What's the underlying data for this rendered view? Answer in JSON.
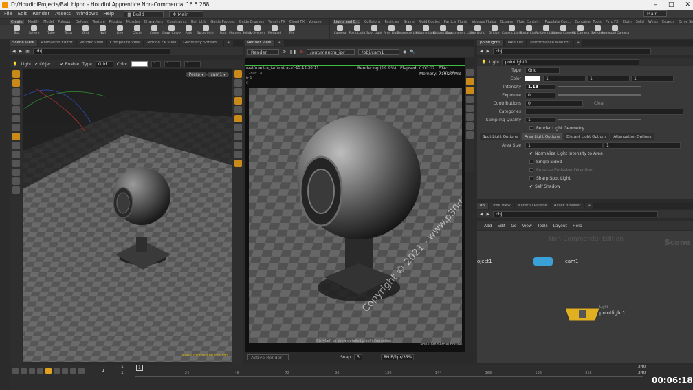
{
  "window": {
    "title": "D:/HoudiniProjects/Ball.hipnc - Houdini Apprentice Non-Commercial 16.5.268",
    "min": "–",
    "max": "□",
    "close": "✕"
  },
  "menu": {
    "items": [
      "File",
      "Edit",
      "Render",
      "Assets",
      "Windows",
      "Help"
    ],
    "build": "Build",
    "desktop": "Main",
    "desktop_right": "Main"
  },
  "shelf_left": {
    "tabs": [
      "Create",
      "Modify",
      "Model",
      "Polygon",
      "Deform",
      "Texture",
      "Rigging",
      "Muscles",
      "Characters",
      "Constraints",
      "Hair Utils",
      "Guide Process",
      "Guide Brushes",
      "Terrain FX",
      "Cloud FX",
      "Volume"
    ],
    "tools": [
      "Box",
      "Sphere",
      "Tube",
      "Torus",
      "Grid",
      "Null",
      "Line",
      "Circle",
      "Curve",
      "Draw Curve",
      "Path",
      "Spray Paint",
      "Font",
      "Platonic Solids",
      "L-System",
      "Metaball",
      "File"
    ]
  },
  "shelf_right": {
    "tabs": [
      "Lights and C...",
      "Collisions",
      "Particles",
      "Grains",
      "Rigid Bodies",
      "Particle Fluids",
      "Viscous Fluids",
      "Oceans",
      "Fluid Contai...",
      "Populate Con...",
      "Container Tools",
      "Pyro FX",
      "Cloth",
      "Solid",
      "Wires",
      "Crowds",
      "Drive Simula..."
    ],
    "tools": [
      "Camera",
      "Point Light",
      "Spot Light",
      "Area Light",
      "Geometry Light",
      "Volume Light",
      "Distant Light",
      "Environment Light",
      "Sky Light",
      "GI Light",
      "Caustic Light",
      "Portal Light",
      "Ambient Light",
      "Stereo Camera",
      "VR Camera",
      "Switcher",
      "Gamepad Camera"
    ]
  },
  "scene_view": {
    "tabs": [
      "Scene View",
      "Animation Editor",
      "Render View",
      "Composite View",
      "Motion FX View",
      "Geometry Spread..."
    ],
    "path": "obj",
    "toolbar": {
      "light": "Light",
      "object": "Object...",
      "enable": "Enable",
      "type": "Type",
      "type_value": "Grid",
      "color": "Color",
      "c1": "1",
      "c2": "1",
      "c3": "1"
    },
    "persp": "Persp ▾",
    "cam": "cam1 ▾",
    "watermark": "Non-Commercial Edition"
  },
  "render_view": {
    "tabs": [
      "Render View"
    ],
    "render_btn": "Render",
    "rop": "/out/mantra_ipr",
    "camera": "/obj/cam1",
    "path_label": "/out/mantra_ipr(raytrace)-15:12:36[1]",
    "resolution": "1280x720",
    "frame": "fr 1",
    "channel": "C",
    "status": "Rendering (19.9%)...",
    "elapsed": "Elapsed: 0:00:07",
    "eta": "ETA: 0:00:28",
    "memory": "Memory:",
    "memory_value": "716.21 MB",
    "hint": "Ctrl+Left to show detailed pixel information.",
    "watermark": "Non-Commercial Edition",
    "copyright": "Copyright © 2021 - www.p30download.com",
    "active_render": "Active Render",
    "snap": "Snap",
    "snap_value": "3",
    "format": "8HIP/1pr/35%"
  },
  "params": {
    "tabs": [
      "pointlight1",
      "Take List",
      "Performance Monitor"
    ],
    "path": "obj",
    "node_type": "Light",
    "node_name": "pointlight1",
    "type_label": "Type",
    "type_value": "Grid",
    "color_label": "Color",
    "color_v1": "1",
    "color_v2": "1",
    "color_v3": "1",
    "intensity_label": "Intensity",
    "intensity": "1.18",
    "exposure_label": "Exposure",
    "exposure": "0",
    "contrib_label": "Contributions",
    "contrib": "0",
    "clear": "Clear",
    "categories_label": "Categories",
    "sampling_label": "Sampling Quality",
    "sampling": "1",
    "render_geo": "Render Light Geometry",
    "subtabs": [
      "Spot Light Options",
      "Area Light Options",
      "Distant Light Options",
      "Attenuation Options"
    ],
    "area_size_label": "Area Size",
    "area_w": "1",
    "area_h": "1",
    "normalize": "Normalize Light Intensity to Area",
    "single_sided": "Single Sided",
    "reverse": "Reverse Emission Direction",
    "sharp_spot": "Sharp Spot Light",
    "self_shadow": "Self Shadow"
  },
  "network": {
    "tabs": [
      "obj",
      "Tree View",
      "Material Palette",
      "Asset Browser"
    ],
    "path": "obj",
    "menu": [
      "Add",
      "Edit",
      "Go",
      "View",
      "Tools",
      "Layout",
      "Help"
    ],
    "watermark": "Non-Commercial Edition",
    "corner": "Scene",
    "nodes": {
      "obj_partial": "oject1",
      "cam": "cam1",
      "light_type": "Light",
      "light": "pointlight1"
    }
  },
  "timeline": {
    "frame": "1",
    "start": "1",
    "start2": "1",
    "current": "1",
    "ticks": [
      "24",
      "48",
      "72",
      "96",
      "120",
      "144",
      "168",
      "192",
      "216"
    ],
    "end1": "240",
    "end2": "240",
    "clock": "00:06:18"
  }
}
